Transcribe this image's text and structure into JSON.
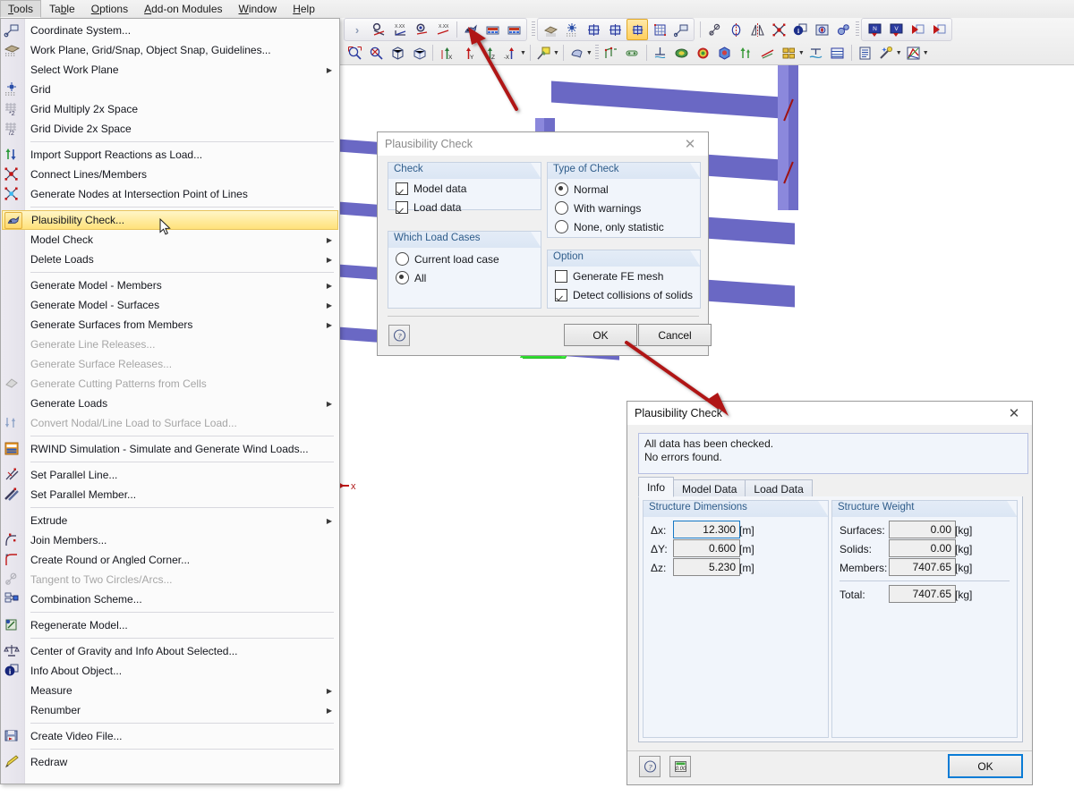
{
  "app": {
    "menubar": [
      {
        "label": "Tools",
        "accel": "T",
        "active": true
      },
      {
        "label": "Table",
        "accel": "b",
        "active": false
      },
      {
        "label": "Options",
        "accel": "O",
        "active": false
      },
      {
        "label": "Add-on Modules",
        "accel": "A",
        "active": false
      },
      {
        "label": "Window",
        "accel": "W",
        "active": false
      },
      {
        "label": "Help",
        "accel": "H",
        "active": false
      }
    ]
  },
  "tools_menu": {
    "items": [
      {
        "label": "Coordinate System...",
        "icon": "coordinate-system-icon",
        "type": "item"
      },
      {
        "label": "Work Plane, Grid/Snap, Object Snap, Guidelines...",
        "icon": "work-plane-icon",
        "type": "item"
      },
      {
        "label": "Select Work Plane",
        "icon": "",
        "type": "submenu"
      },
      {
        "label": "Grid",
        "icon": "grid-icon",
        "type": "item"
      },
      {
        "label": "Grid Multiply 2x Space",
        "icon": "grid-multiply-icon",
        "type": "item"
      },
      {
        "label": "Grid Divide 2x Space",
        "icon": "grid-divide-icon",
        "type": "item"
      },
      {
        "type": "separator"
      },
      {
        "label": "Import Support Reactions as Load...",
        "icon": "import-reactions-icon",
        "type": "item"
      },
      {
        "label": "Connect Lines/Members",
        "icon": "connect-lines-icon",
        "type": "item"
      },
      {
        "label": "Generate Nodes at Intersection Point of Lines",
        "icon": "intersection-nodes-icon",
        "type": "item"
      },
      {
        "type": "separator"
      },
      {
        "label": "Plausibility Check...",
        "icon": "plausibility-check-icon",
        "type": "item",
        "highlighted": true
      },
      {
        "label": "Model Check",
        "icon": "",
        "type": "submenu"
      },
      {
        "label": "Delete Loads",
        "icon": "",
        "type": "submenu"
      },
      {
        "type": "separator"
      },
      {
        "label": "Generate Model - Members",
        "icon": "",
        "type": "submenu"
      },
      {
        "label": "Generate Model - Surfaces",
        "icon": "",
        "type": "submenu"
      },
      {
        "label": "Generate Surfaces from Members",
        "icon": "",
        "type": "submenu"
      },
      {
        "label": "Generate Line Releases...",
        "icon": "",
        "type": "item",
        "disabled": true
      },
      {
        "label": "Generate Surface Releases...",
        "icon": "",
        "type": "item",
        "disabled": true
      },
      {
        "label": "Generate Cutting Patterns from Cells",
        "icon": "cutting-pattern-icon",
        "type": "item",
        "disabled": true
      },
      {
        "label": "Generate Loads",
        "icon": "",
        "type": "submenu"
      },
      {
        "label": "Convert Nodal/Line Load to Surface Load...",
        "icon": "convert-load-icon",
        "type": "item",
        "disabled": true
      },
      {
        "type": "separator"
      },
      {
        "label": "RWIND Simulation - Simulate and Generate Wind Loads...",
        "icon": "rwind-icon",
        "type": "item"
      },
      {
        "type": "separator"
      },
      {
        "label": "Set Parallel Line...",
        "icon": "parallel-line-icon",
        "type": "item"
      },
      {
        "label": "Set Parallel Member...",
        "icon": "parallel-member-icon",
        "type": "item"
      },
      {
        "type": "separator"
      },
      {
        "label": "Extrude",
        "icon": "",
        "type": "submenu"
      },
      {
        "label": "Join Members...",
        "icon": "join-members-icon",
        "type": "item"
      },
      {
        "label": "Create Round or Angled Corner...",
        "icon": "round-corner-icon",
        "type": "item"
      },
      {
        "label": "Tangent to Two Circles/Arcs...",
        "icon": "tangent-circles-icon",
        "type": "item",
        "disabled": true
      },
      {
        "label": "Combination Scheme...",
        "icon": "combination-scheme-icon",
        "type": "item"
      },
      {
        "type": "separator"
      },
      {
        "label": "Regenerate Model...",
        "icon": "regenerate-model-icon",
        "type": "item"
      },
      {
        "type": "separator"
      },
      {
        "label": "Center of Gravity and Info About Selected...",
        "icon": "center-gravity-icon",
        "type": "item"
      },
      {
        "label": "Info About Object...",
        "icon": "info-object-icon",
        "type": "item"
      },
      {
        "label": "Measure",
        "icon": "",
        "type": "submenu"
      },
      {
        "label": "Renumber",
        "icon": "",
        "type": "submenu"
      },
      {
        "type": "separator"
      },
      {
        "label": "Create Video File...",
        "icon": "create-video-icon",
        "type": "item"
      },
      {
        "type": "separator"
      },
      {
        "label": "Redraw",
        "icon": "redraw-icon",
        "type": "item"
      }
    ]
  },
  "settings_dialog": {
    "title": "Plausibility Check",
    "close_label": "✕",
    "groups": {
      "check": {
        "title": "Check",
        "options": [
          {
            "label": "Model data",
            "checked": true
          },
          {
            "label": "Load data",
            "checked": true
          }
        ]
      },
      "which_load_cases": {
        "title": "Which Load Cases",
        "options": [
          {
            "label": "Current load case",
            "selected": false
          },
          {
            "label": "All",
            "selected": true
          }
        ]
      },
      "type_of_check": {
        "title": "Type of Check",
        "options": [
          {
            "label": "Normal",
            "selected": true
          },
          {
            "label": "With warnings",
            "selected": false
          },
          {
            "label": "None, only statistic",
            "selected": false
          }
        ]
      },
      "option": {
        "title": "Option",
        "options": [
          {
            "label": "Generate FE mesh",
            "checked": false
          },
          {
            "label": "Detect collisions of solids",
            "checked": true
          }
        ]
      }
    },
    "help_icon": "help-icon",
    "ok_label": "OK",
    "cancel_label": "Cancel"
  },
  "result_dialog": {
    "title": "Plausibility Check",
    "close_label": "✕",
    "message_line1": "All data has been checked.",
    "message_line2": "No errors found.",
    "tabs": [
      {
        "label": "Info",
        "selected": true
      },
      {
        "label": "Model Data",
        "selected": false
      },
      {
        "label": "Load Data",
        "selected": false
      }
    ],
    "structure_dimensions": {
      "title": "Structure Dimensions",
      "rows": [
        {
          "label": "Δx:",
          "value": "12.300",
          "unit": "[m]",
          "focused": true
        },
        {
          "label": "ΔY:",
          "value": "0.600",
          "unit": "[m]",
          "focused": false
        },
        {
          "label": "Δz:",
          "value": "5.230",
          "unit": "[m]",
          "focused": false
        }
      ]
    },
    "structure_weight": {
      "title": "Structure Weight",
      "rows": [
        {
          "label": "Surfaces:",
          "value": "0.00",
          "unit": "[kg]"
        },
        {
          "label": "Solids:",
          "value": "0.00",
          "unit": "[kg]"
        },
        {
          "label": "Members:",
          "value": "7407.65",
          "unit": "[kg]"
        }
      ],
      "total": {
        "label": "Total:",
        "value": "7407.65",
        "unit": "[kg]"
      }
    },
    "help_icon": "help-icon",
    "units_icon": "units-icon",
    "ok_label": "OK"
  },
  "viewport": {
    "axis_label_x": "x"
  },
  "colors": {
    "accent_blue": "#1778c4",
    "group_header_text": "#2e5c8a",
    "highlight_yellow": "#ffe27a",
    "annotation_red": "#b01818",
    "member_purple": "#6a68c4",
    "support_green": "#56ef56"
  }
}
